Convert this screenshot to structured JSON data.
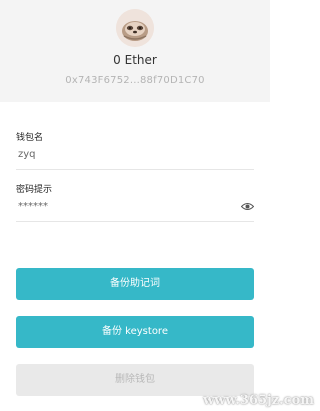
{
  "wallet": {
    "balance": "0 Ether",
    "address": "0x743F6752...88f70D1C70"
  },
  "form": {
    "name_label": "钱包名",
    "name_value": "zyq",
    "hint_label": "密码提示",
    "hint_value": "******"
  },
  "actions": {
    "backup_mnemonic": "备份助记词",
    "backup_keystore": "备份 keystore",
    "delete_wallet": "删除钱包"
  },
  "watermark": "www.365jz.com",
  "colors": {
    "primary": "#36b8c8",
    "header_bg": "#f4f4f4",
    "disabled_bg": "#e9e9e9"
  }
}
